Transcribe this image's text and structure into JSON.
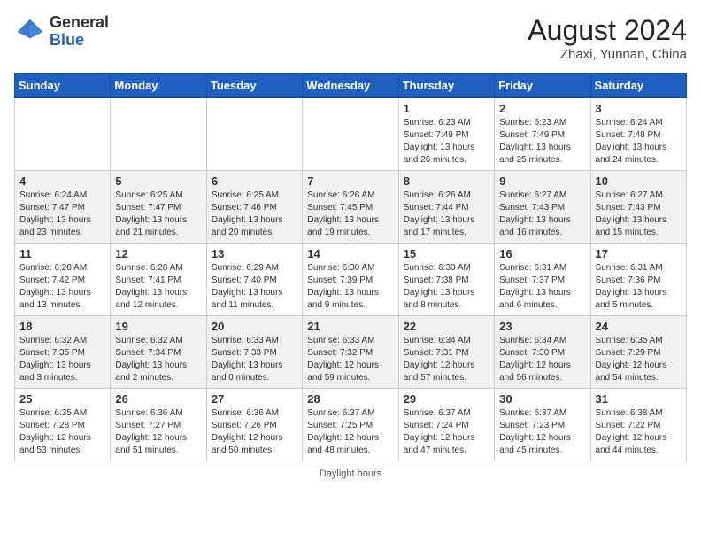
{
  "header": {
    "logo_general": "General",
    "logo_blue": "Blue",
    "month_year": "August 2024",
    "location": "Zhaxi, Yunnan, China"
  },
  "days_of_week": [
    "Sunday",
    "Monday",
    "Tuesday",
    "Wednesday",
    "Thursday",
    "Friday",
    "Saturday"
  ],
  "weeks": [
    [
      {
        "day": "",
        "info": ""
      },
      {
        "day": "",
        "info": ""
      },
      {
        "day": "",
        "info": ""
      },
      {
        "day": "",
        "info": ""
      },
      {
        "day": "1",
        "info": "Sunrise: 6:23 AM\nSunset: 7:49 PM\nDaylight: 13 hours\nand 26 minutes."
      },
      {
        "day": "2",
        "info": "Sunrise: 6:23 AM\nSunset: 7:49 PM\nDaylight: 13 hours\nand 25 minutes."
      },
      {
        "day": "3",
        "info": "Sunrise: 6:24 AM\nSunset: 7:48 PM\nDaylight: 13 hours\nand 24 minutes."
      }
    ],
    [
      {
        "day": "4",
        "info": "Sunrise: 6:24 AM\nSunset: 7:47 PM\nDaylight: 13 hours\nand 23 minutes."
      },
      {
        "day": "5",
        "info": "Sunrise: 6:25 AM\nSunset: 7:47 PM\nDaylight: 13 hours\nand 21 minutes."
      },
      {
        "day": "6",
        "info": "Sunrise: 6:25 AM\nSunset: 7:46 PM\nDaylight: 13 hours\nand 20 minutes."
      },
      {
        "day": "7",
        "info": "Sunrise: 6:26 AM\nSunset: 7:45 PM\nDaylight: 13 hours\nand 19 minutes."
      },
      {
        "day": "8",
        "info": "Sunrise: 6:26 AM\nSunset: 7:44 PM\nDaylight: 13 hours\nand 17 minutes."
      },
      {
        "day": "9",
        "info": "Sunrise: 6:27 AM\nSunset: 7:43 PM\nDaylight: 13 hours\nand 16 minutes."
      },
      {
        "day": "10",
        "info": "Sunrise: 6:27 AM\nSunset: 7:43 PM\nDaylight: 13 hours\nand 15 minutes."
      }
    ],
    [
      {
        "day": "11",
        "info": "Sunrise: 6:28 AM\nSunset: 7:42 PM\nDaylight: 13 hours\nand 13 minutes."
      },
      {
        "day": "12",
        "info": "Sunrise: 6:28 AM\nSunset: 7:41 PM\nDaylight: 13 hours\nand 12 minutes."
      },
      {
        "day": "13",
        "info": "Sunrise: 6:29 AM\nSunset: 7:40 PM\nDaylight: 13 hours\nand 11 minutes."
      },
      {
        "day": "14",
        "info": "Sunrise: 6:30 AM\nSunset: 7:39 PM\nDaylight: 13 hours\nand 9 minutes."
      },
      {
        "day": "15",
        "info": "Sunrise: 6:30 AM\nSunset: 7:38 PM\nDaylight: 13 hours\nand 8 minutes."
      },
      {
        "day": "16",
        "info": "Sunrise: 6:31 AM\nSunset: 7:37 PM\nDaylight: 13 hours\nand 6 minutes."
      },
      {
        "day": "17",
        "info": "Sunrise: 6:31 AM\nSunset: 7:36 PM\nDaylight: 13 hours\nand 5 minutes."
      }
    ],
    [
      {
        "day": "18",
        "info": "Sunrise: 6:32 AM\nSunset: 7:35 PM\nDaylight: 13 hours\nand 3 minutes."
      },
      {
        "day": "19",
        "info": "Sunrise: 6:32 AM\nSunset: 7:34 PM\nDaylight: 13 hours\nand 2 minutes."
      },
      {
        "day": "20",
        "info": "Sunrise: 6:33 AM\nSunset: 7:33 PM\nDaylight: 13 hours\nand 0 minutes."
      },
      {
        "day": "21",
        "info": "Sunrise: 6:33 AM\nSunset: 7:32 PM\nDaylight: 12 hours\nand 59 minutes."
      },
      {
        "day": "22",
        "info": "Sunrise: 6:34 AM\nSunset: 7:31 PM\nDaylight: 12 hours\nand 57 minutes."
      },
      {
        "day": "23",
        "info": "Sunrise: 6:34 AM\nSunset: 7:30 PM\nDaylight: 12 hours\nand 56 minutes."
      },
      {
        "day": "24",
        "info": "Sunrise: 6:35 AM\nSunset: 7:29 PM\nDaylight: 12 hours\nand 54 minutes."
      }
    ],
    [
      {
        "day": "25",
        "info": "Sunrise: 6:35 AM\nSunset: 7:28 PM\nDaylight: 12 hours\nand 53 minutes."
      },
      {
        "day": "26",
        "info": "Sunrise: 6:36 AM\nSunset: 7:27 PM\nDaylight: 12 hours\nand 51 minutes."
      },
      {
        "day": "27",
        "info": "Sunrise: 6:36 AM\nSunset: 7:26 PM\nDaylight: 12 hours\nand 50 minutes."
      },
      {
        "day": "28",
        "info": "Sunrise: 6:37 AM\nSunset: 7:25 PM\nDaylight: 12 hours\nand 48 minutes."
      },
      {
        "day": "29",
        "info": "Sunrise: 6:37 AM\nSunset: 7:24 PM\nDaylight: 12 hours\nand 47 minutes."
      },
      {
        "day": "30",
        "info": "Sunrise: 6:37 AM\nSunset: 7:23 PM\nDaylight: 12 hours\nand 45 minutes."
      },
      {
        "day": "31",
        "info": "Sunrise: 6:38 AM\nSunset: 7:22 PM\nDaylight: 12 hours\nand 44 minutes."
      }
    ]
  ],
  "footer": {
    "daylight_hours": "Daylight hours"
  }
}
